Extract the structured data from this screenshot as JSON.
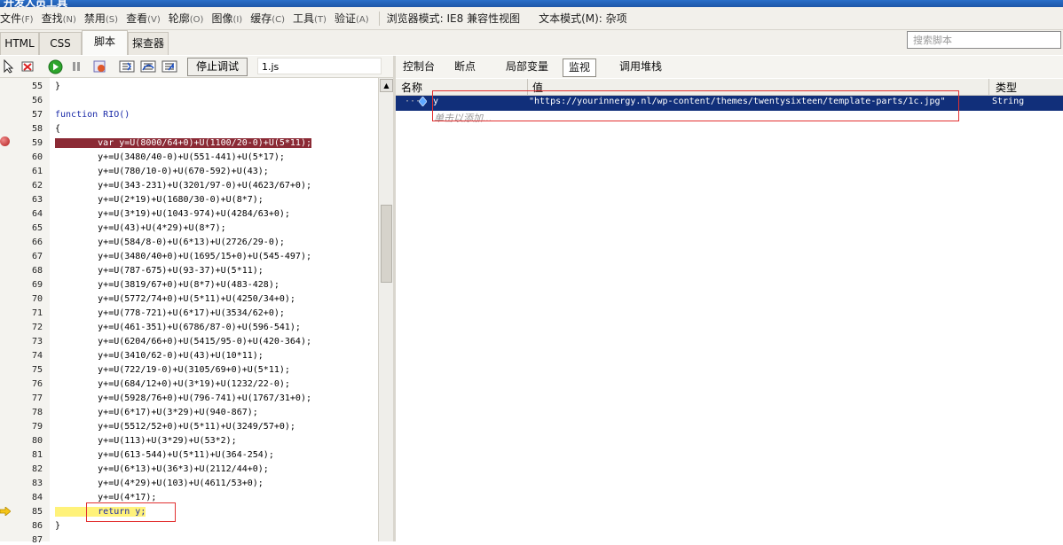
{
  "title": "开发人员工具",
  "menu": {
    "items": [
      {
        "label": "文件",
        "key": "(F)"
      },
      {
        "label": "查找",
        "key": "(N)"
      },
      {
        "label": "禁用",
        "key": "(S)"
      },
      {
        "label": "查看",
        "key": "(V)"
      },
      {
        "label": "轮廓",
        "key": "(O)"
      },
      {
        "label": "图像",
        "key": "(I)"
      },
      {
        "label": "缓存",
        "key": "(C)"
      },
      {
        "label": "工具",
        "key": "(T)"
      },
      {
        "label": "验证",
        "key": "(A)"
      }
    ],
    "browser_mode": "浏览器模式: IE8 兼容性视图",
    "doc_mode": "文本模式(M): 杂项"
  },
  "tabs": [
    "HTML",
    "CSS",
    "脚本",
    "探查器"
  ],
  "search": {
    "placeholder": "搜索脚本"
  },
  "toolbar": {
    "stop_debug": "停止调试",
    "file": "1.js"
  },
  "code": {
    "line_numbers": [
      "55",
      "56",
      "57",
      "58",
      "59",
      "60",
      "61",
      "62",
      "63",
      "64",
      "65",
      "66",
      "67",
      "68",
      "69",
      "70",
      "71",
      "72",
      "73",
      "74",
      "75",
      "76",
      "77",
      "78",
      "79",
      "80",
      "81",
      "82",
      "83",
      "84",
      "85",
      "86",
      "87"
    ],
    "lines": [
      "}",
      "",
      "function RIO()",
      "{",
      "        var y=U(8000/64+0)+U(1100/20-0)+U(5*11);",
      "        y+=U(3480/40-0)+U(551-441)+U(5*17);",
      "        y+=U(780/10-0)+U(670-592)+U(43);",
      "        y+=U(343-231)+U(3201/97-0)+U(4623/67+0);",
      "        y+=U(2*19)+U(1680/30-0)+U(8*7);",
      "        y+=U(3*19)+U(1043-974)+U(4284/63+0);",
      "        y+=U(43)+U(4*29)+U(8*7);",
      "        y+=U(584/8-0)+U(6*13)+U(2726/29-0);",
      "        y+=U(3480/40+0)+U(1695/15+0)+U(545-497);",
      "        y+=U(787-675)+U(93-37)+U(5*11);",
      "        y+=U(3819/67+0)+U(8*7)+U(483-428);",
      "        y+=U(5772/74+0)+U(5*11)+U(4250/34+0);",
      "        y+=U(778-721)+U(6*17)+U(3534/62+0);",
      "        y+=U(461-351)+U(6786/87-0)+U(596-541);",
      "        y+=U(6204/66+0)+U(5415/95-0)+U(420-364);",
      "        y+=U(3410/62-0)+U(43)+U(10*11);",
      "        y+=U(722/19-0)+U(3105/69+0)+U(5*11);",
      "        y+=U(684/12+0)+U(3*19)+U(1232/22-0);",
      "        y+=U(5928/76+0)+U(796-741)+U(1767/31+0);",
      "        y+=U(6*17)+U(3*29)+U(940-867);",
      "        y+=U(5512/52+0)+U(5*11)+U(3249/57+0);",
      "        y+=U(113)+U(3*29)+U(53*2);",
      "        y+=U(613-544)+U(5*11)+U(364-254);",
      "        y+=U(6*13)+U(36*3)+U(2112/44+0);",
      "        y+=U(4*29)+U(103)+U(4611/53+0);",
      "        y+=U(4*17);",
      "        return y;",
      "}",
      ""
    ]
  },
  "right_tabs": [
    "控制台",
    "断点",
    "局部变量",
    "监视",
    "调用堆栈"
  ],
  "watch": {
    "headers": {
      "name": "名称",
      "value": "值",
      "type": "类型"
    },
    "rows": [
      {
        "name": "y",
        "value": "\"https://yourinnergy.nl/wp-content/themes/twentysixteen/template-parts/1c.jpg\"",
        "type": "String"
      }
    ],
    "add_hint": "单击以添加..."
  }
}
